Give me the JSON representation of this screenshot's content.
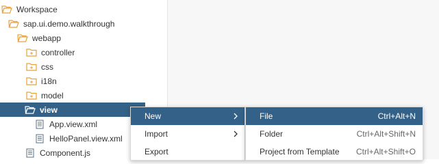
{
  "tree": {
    "items": [
      {
        "label": "Workspace",
        "icon": "folder-open-icon"
      },
      {
        "label": "sap.ui.demo.walkthrough",
        "icon": "folder-open-icon"
      },
      {
        "label": "webapp",
        "icon": "folder-open-icon"
      },
      {
        "label": "controller",
        "icon": "folder-icon"
      },
      {
        "label": "css",
        "icon": "folder-icon"
      },
      {
        "label": "i18n",
        "icon": "folder-icon"
      },
      {
        "label": "model",
        "icon": "folder-icon"
      },
      {
        "label": "view",
        "icon": "folder-open-icon",
        "selected": true
      },
      {
        "label": "App.view.xml",
        "icon": "file-icon"
      },
      {
        "label": "HelloPanel.view.xml",
        "icon": "file-icon"
      },
      {
        "label": "Component.js",
        "icon": "file-icon"
      }
    ]
  },
  "context_menu": {
    "items": [
      {
        "label": "New",
        "has_submenu": true,
        "active": true
      },
      {
        "label": "Import",
        "has_submenu": true
      },
      {
        "label": "Export",
        "has_submenu": false
      }
    ]
  },
  "submenu": {
    "items": [
      {
        "label": "File",
        "shortcut": "Ctrl+Alt+N",
        "active": true
      },
      {
        "label": "Folder",
        "shortcut": "Ctrl+Alt+Shift+N"
      },
      {
        "label": "Project from Template",
        "shortcut": "Ctrl+Alt+Shift+O"
      }
    ]
  },
  "colors": {
    "selection": "#346187",
    "folder": "#e8a13a",
    "file": "#5a6f82"
  }
}
